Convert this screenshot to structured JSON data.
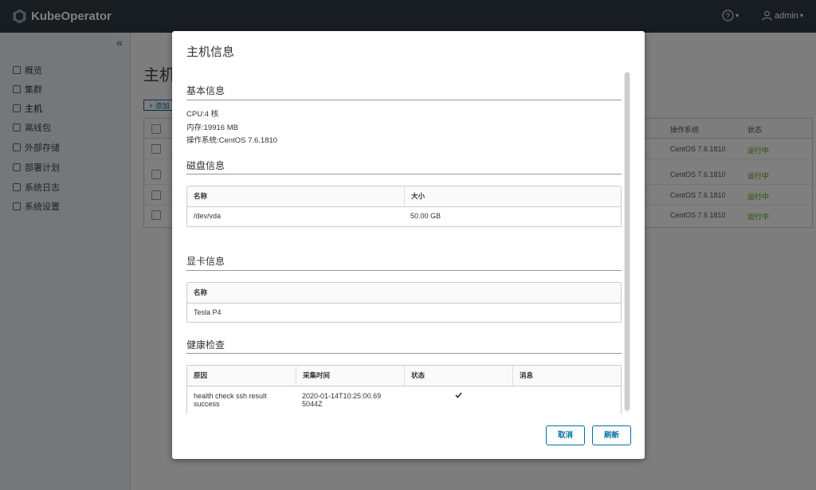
{
  "app": {
    "logo_text": "KubeOperator",
    "help_icon": "help-circle-icon",
    "user": "admin"
  },
  "sidebar": {
    "items": [
      {
        "label": "概览",
        "icon": "overview-icon"
      },
      {
        "label": "集群",
        "icon": "cluster-icon"
      },
      {
        "label": "主机",
        "icon": "host-icon"
      },
      {
        "label": "离线包",
        "icon": "package-icon"
      },
      {
        "label": "外部存储",
        "icon": "storage-icon"
      },
      {
        "label": "部署计划",
        "icon": "plan-icon"
      },
      {
        "label": "系统日志",
        "icon": "log-icon"
      },
      {
        "label": "系统设置",
        "icon": "settings-icon"
      }
    ]
  },
  "main": {
    "title": "主机",
    "add_label": "+ 添加",
    "table": {
      "col_os": "操作系统",
      "col_status": "状态",
      "rows": [
        {
          "os": "CentOS 7.6.1810",
          "status": "运行中"
        },
        {
          "os": "CentOS 7.6.1810",
          "status": "运行中"
        },
        {
          "os": "CentOS 7.6.1810",
          "status": "运行中"
        },
        {
          "os": "CentOS 7.6.1810",
          "status": "运行中"
        }
      ]
    }
  },
  "modal": {
    "title": "主机信息",
    "basic": {
      "heading": "基本信息",
      "cpu": "CPU:4 核",
      "memory": "内存:19916 MB",
      "os": "操作系统:CentOS 7.6.1810"
    },
    "disk": {
      "heading": "磁盘信息",
      "col_name": "名称",
      "col_size": "大小",
      "rows": [
        {
          "name": "/dev/vda",
          "size": "50.00 GB"
        }
      ]
    },
    "gpu": {
      "heading": "显卡信息",
      "col_name": "名称",
      "rows": [
        {
          "name": "Tesla P4"
        }
      ]
    },
    "health": {
      "heading": "健康检查",
      "col_reason": "原因",
      "col_time": "采集时间",
      "col_status": "状态",
      "col_message": "消息",
      "rows": [
        {
          "reason": "health check ssh result success",
          "time": "2020-01-14T10:25:00.695044Z",
          "status_icon": "check-icon",
          "message": ""
        }
      ]
    },
    "cancel_label": "取消",
    "refresh_label": "刷新"
  }
}
